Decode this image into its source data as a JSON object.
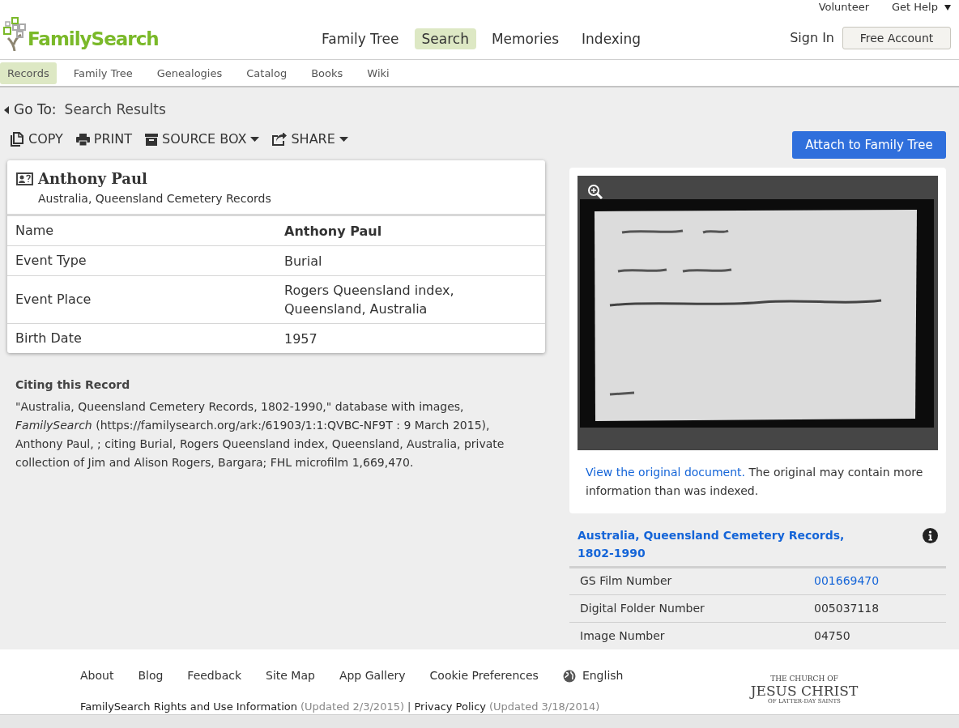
{
  "header": {
    "logo": "FamilySearch",
    "utility_links": [
      {
        "label": "Volunteer",
        "dropdown": false
      },
      {
        "label": "Get Help",
        "dropdown": true
      }
    ],
    "nav": [
      {
        "label": "Family Tree",
        "selected": false
      },
      {
        "label": "Search",
        "selected": true
      },
      {
        "label": "Memories",
        "selected": false
      },
      {
        "label": "Indexing",
        "selected": false
      }
    ],
    "sign_in": "Sign In",
    "account_button": "Free Account"
  },
  "subnav": [
    {
      "label": "Records",
      "selected": true
    },
    {
      "label": "Family Tree",
      "selected": false
    },
    {
      "label": "Genealogies",
      "selected": false
    },
    {
      "label": "Catalog",
      "selected": false
    },
    {
      "label": "Books",
      "selected": false
    },
    {
      "label": "Wiki",
      "selected": false
    }
  ],
  "breadcrumb": {
    "label": "Go To:",
    "link": "Search Results"
  },
  "toolbar": [
    {
      "label": "COPY",
      "kind": "copy",
      "dropdown": false
    },
    {
      "label": "PRINT",
      "kind": "print",
      "dropdown": false
    },
    {
      "label": "SOURCE BOX",
      "kind": "box",
      "dropdown": true
    },
    {
      "label": "SHARE",
      "kind": "share",
      "dropdown": true
    }
  ],
  "attach_button": "Attach to Family Tree",
  "record": {
    "name": "Anthony Paul",
    "collection": "Australia, Queensland Cemetery Records",
    "rows": [
      {
        "label": "Name",
        "value": "Anthony Paul",
        "bold": true
      },
      {
        "label": "Event Type",
        "value": "Burial",
        "bold": false
      },
      {
        "label": "Event Place",
        "value": "Rogers Queensland index, Queensland, Australia",
        "bold": false
      },
      {
        "label": "Birth Date",
        "value": "1957",
        "bold": false
      }
    ]
  },
  "citation": {
    "title": "Citing this Record",
    "text": "\"Australia, Queensland Cemetery Records, 1802-1990,\" database with images, *FamilySearch* (https://familysearch.org/ark:/61903/1:1:QVBC-NF9T : 9 March 2015), Anthony Paul, ; citing Burial, Rogers Queensland index, Queensland, Australia, private collection of Jim and Alison Rogers, Bargara; FHL microfilm 1,669,470."
  },
  "document": {
    "kind": "picture",
    "link": "View the original document.",
    "note": " The original may contain more information than was indexed."
  },
  "film": {
    "title": "Australia, Queensland Cemetery Records, 1802-1990",
    "rows": [
      {
        "label": "GS Film Number",
        "value": "001669470",
        "link": true
      },
      {
        "label": "Digital Folder Number",
        "value": "005037118",
        "link": false
      },
      {
        "label": "Image Number",
        "value": "04750",
        "link": false
      }
    ]
  },
  "footer": {
    "links": [
      "About",
      "Blog",
      "Feedback",
      "Site Map",
      "App Gallery",
      "Cookie Preferences"
    ],
    "language": "English",
    "legal": [
      {
        "text": "FamilySearch Rights and Use Information",
        "kind": "link"
      },
      {
        "text": "(Updated 2/3/2015)",
        "kind": "note"
      },
      {
        "text": "|",
        "kind": "separator"
      },
      {
        "text": "Privacy Policy",
        "kind": "link"
      },
      {
        "text": "(Updated 3/18/2014)",
        "kind": "note"
      }
    ],
    "church_logo": [
      "THE CHURCH OF",
      "JESUS CHRIST",
      "OF LATTER-DAY SAINTS"
    ]
  }
}
